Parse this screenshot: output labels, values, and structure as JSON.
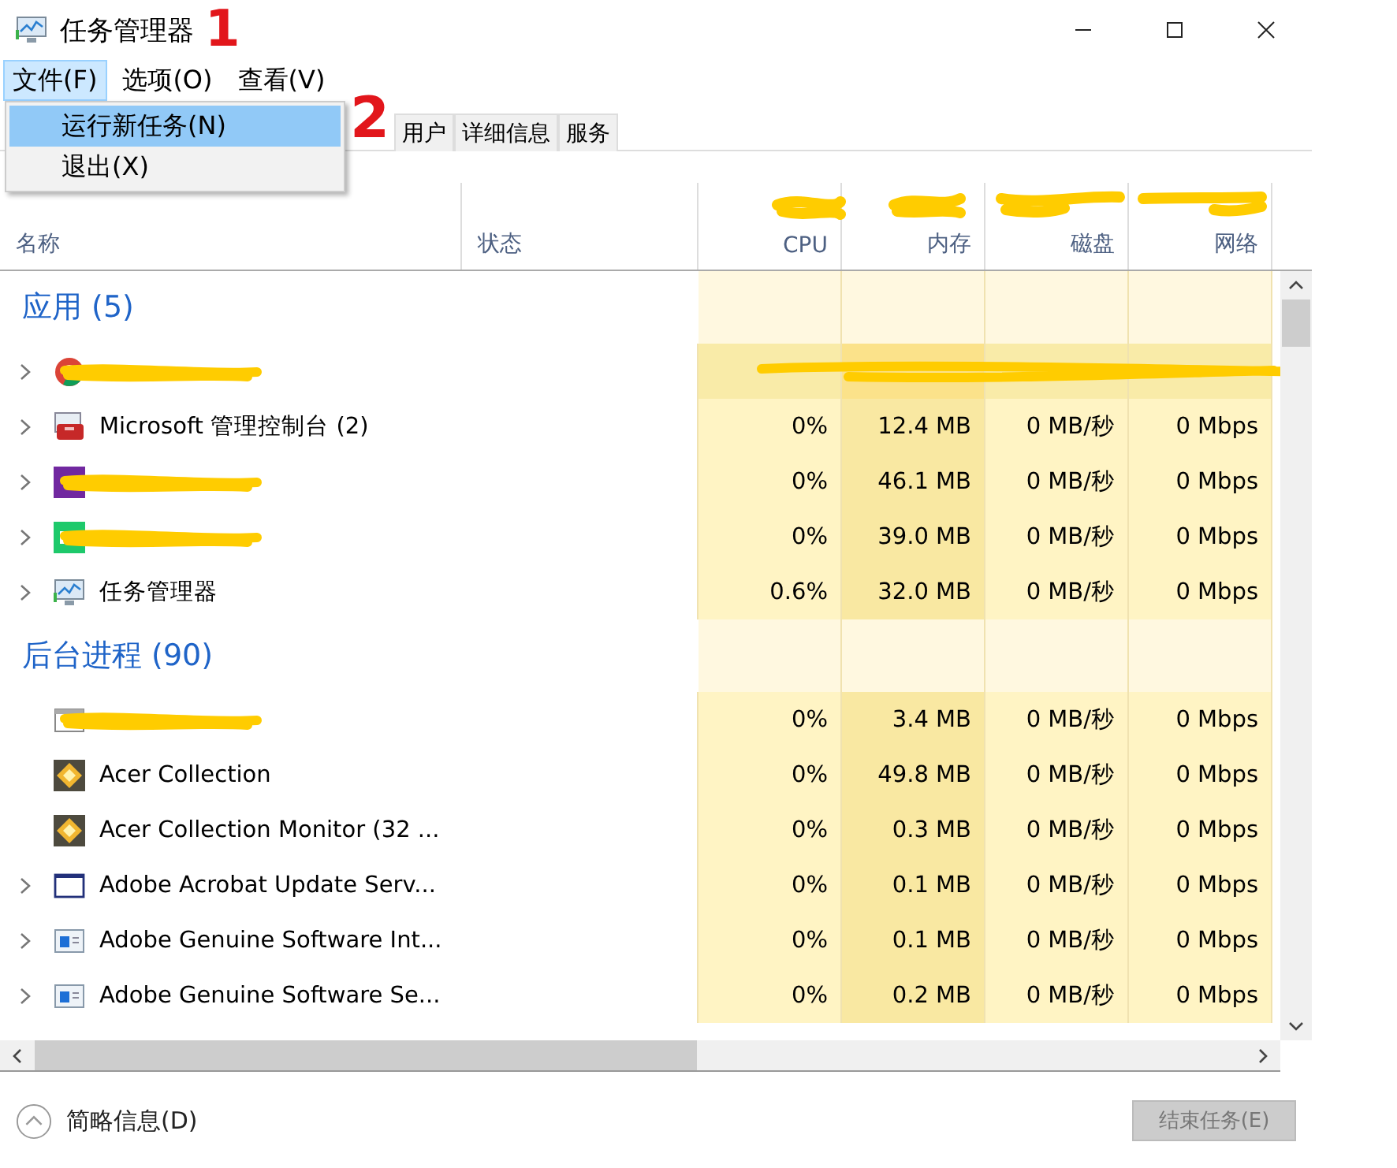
{
  "window": {
    "title": "任务管理器"
  },
  "menu": [
    {
      "label": "文件(F)",
      "selected": true
    },
    {
      "label": "选项(O)",
      "selected": false
    },
    {
      "label": "查看(V)",
      "selected": false
    }
  ],
  "dropdown": [
    {
      "label": "运行新任务(N)",
      "selected": true
    },
    {
      "label": "退出(X)",
      "selected": false
    }
  ],
  "tabs": [
    {
      "label": "用户",
      "selected": false
    },
    {
      "label": "详细信息",
      "selected": false
    },
    {
      "label": "服务",
      "selected": false
    }
  ],
  "annotations": [
    {
      "label": "1"
    },
    {
      "label": "2"
    }
  ],
  "table": {
    "columns": [
      {
        "label": "名称"
      },
      {
        "label": "状态"
      },
      {
        "label": "CPU"
      },
      {
        "label": "内存"
      },
      {
        "label": "磁盘"
      },
      {
        "label": "网络"
      }
    ],
    "groups": [
      {
        "title": "应用 (5)",
        "rows": [
          {
            "kind": "redacted",
            "expandable": true
          },
          {
            "kind": "process",
            "expandable": true,
            "name": "Microsoft 管理控制台 (2)",
            "cpu": "0%",
            "memory": "12.4 MB",
            "disk": "0 MB/秒",
            "network": "0 Mbps"
          },
          {
            "kind": "redacted",
            "expandable": true,
            "cpu": "0%",
            "memory": "46.1 MB",
            "disk": "0 MB/秒",
            "network": "0 Mbps"
          },
          {
            "kind": "redacted",
            "expandable": true,
            "cpu": "0%",
            "memory": "39.0 MB",
            "disk": "0 MB/秒",
            "network": "0 Mbps"
          },
          {
            "kind": "process",
            "expandable": true,
            "name": "任务管理器",
            "cpu": "0.6%",
            "memory": "32.0 MB",
            "disk": "0 MB/秒",
            "network": "0 Mbps"
          }
        ]
      },
      {
        "title": "后台进程 (90)",
        "rows": [
          {
            "kind": "redacted",
            "expandable": false,
            "cpu": "0%",
            "memory": "3.4 MB",
            "disk": "0 MB/秒",
            "network": "0 Mbps"
          },
          {
            "kind": "process",
            "expandable": false,
            "name": "Acer Collection",
            "cpu": "0%",
            "memory": "49.8 MB",
            "disk": "0 MB/秒",
            "network": "0 Mbps"
          },
          {
            "kind": "process",
            "expandable": false,
            "name": "Acer Collection Monitor (32 ...",
            "cpu": "0%",
            "memory": "0.3 MB",
            "disk": "0 MB/秒",
            "network": "0 Mbps"
          },
          {
            "kind": "process",
            "expandable": true,
            "name": "Adobe Acrobat Update Serv...",
            "cpu": "0%",
            "memory": "0.1 MB",
            "disk": "0 MB/秒",
            "network": "0 Mbps"
          },
          {
            "kind": "process",
            "expandable": true,
            "name": "Adobe Genuine Software Int...",
            "cpu": "0%",
            "memory": "0.1 MB",
            "disk": "0 MB/秒",
            "network": "0 Mbps"
          },
          {
            "kind": "process",
            "expandable": true,
            "name": "Adobe Genuine Software Se...",
            "cpu": "0%",
            "memory": "0.2 MB",
            "disk": "0 MB/秒",
            "network": "0 Mbps"
          }
        ]
      }
    ]
  },
  "footer": {
    "details": "简略信息(D)",
    "end_task": {
      "label": "结束任务(E)",
      "disabled": true
    }
  }
}
